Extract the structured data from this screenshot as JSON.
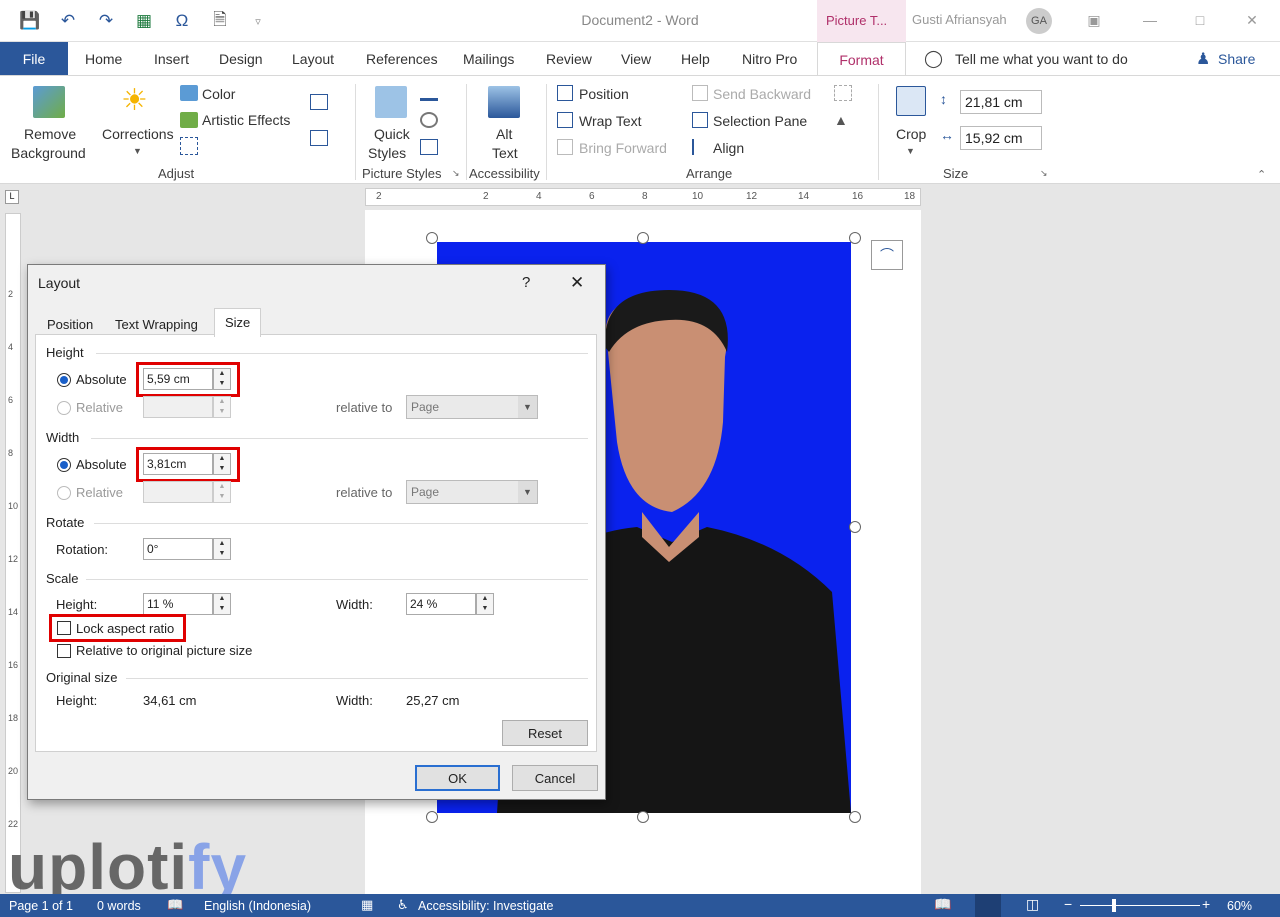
{
  "window": {
    "doc_title": "Document2  -  Word",
    "context_tab": "Picture T...",
    "user": "Gusti Afriansyah",
    "avatar": "GA"
  },
  "tabs": {
    "file": "File",
    "items": [
      "Home",
      "Insert",
      "Design",
      "Layout",
      "References",
      "Mailings",
      "Review",
      "View",
      "Help",
      "Nitro Pro"
    ],
    "format": "Format",
    "tell_me": "Tell me what you want to do",
    "share": "Share"
  },
  "ribbon": {
    "adjust": {
      "remove_bg_1": "Remove",
      "remove_bg_2": "Background",
      "corrections": "Corrections",
      "color": "Color",
      "artistic": "Artistic Effects",
      "label": "Adjust"
    },
    "styles": {
      "quick_1": "Quick",
      "quick_2": "Styles",
      "label": "Picture Styles"
    },
    "accessibility": {
      "alt_1": "Alt",
      "alt_2": "Text",
      "label": "Accessibility"
    },
    "arrange": {
      "position": "Position",
      "wrap": "Wrap Text",
      "bring_forward": "Bring Forward",
      "send_backward": "Send Backward",
      "selection_pane": "Selection Pane",
      "align": "Align",
      "label": "Arrange"
    },
    "size": {
      "crop": "Crop",
      "height": "21,81 cm",
      "width": "15,92 cm",
      "label": "Size"
    }
  },
  "ruler": {
    "ticks": [
      "2",
      "2",
      "4",
      "6",
      "8",
      "10",
      "12",
      "14",
      "16",
      "18"
    ],
    "vticks": [
      "2",
      "4",
      "6",
      "8",
      "10",
      "12",
      "14",
      "16",
      "18",
      "20",
      "22"
    ]
  },
  "dialog": {
    "title": "Layout",
    "help": "?",
    "close": "✕",
    "tabs": [
      "Position",
      "Text Wrapping",
      "Size"
    ],
    "height": {
      "section": "Height",
      "absolute": "Absolute",
      "absolute_value": "5,59 cm",
      "relative": "Relative",
      "relative_to": "relative to",
      "relative_to_value": "Page"
    },
    "width": {
      "section": "Width",
      "absolute": "Absolute",
      "absolute_value": "3,81cm",
      "relative": "Relative",
      "relative_to": "relative to",
      "relative_to_value": "Page"
    },
    "rotate": {
      "section": "Rotate",
      "label": "Rotation:",
      "value": "0°"
    },
    "scale": {
      "section": "Scale",
      "height_label": "Height:",
      "height_value": "11 %",
      "width_label": "Width:",
      "width_value": "24 %",
      "lock_aspect": "Lock aspect ratio",
      "relative_original": "Relative to original picture size"
    },
    "original": {
      "section": "Original size",
      "height_label": "Height:",
      "height_value": "34,61 cm",
      "width_label": "Width:",
      "width_value": "25,27 cm"
    },
    "reset": "Reset",
    "ok": "OK",
    "cancel": "Cancel"
  },
  "status": {
    "page": "Page 1 of 1",
    "words": "0 words",
    "language": "English (Indonesia)",
    "accessibility": "Accessibility: Investigate",
    "zoom": "60%"
  },
  "watermark": {
    "part1": "uploti",
    "part2": "fy"
  }
}
